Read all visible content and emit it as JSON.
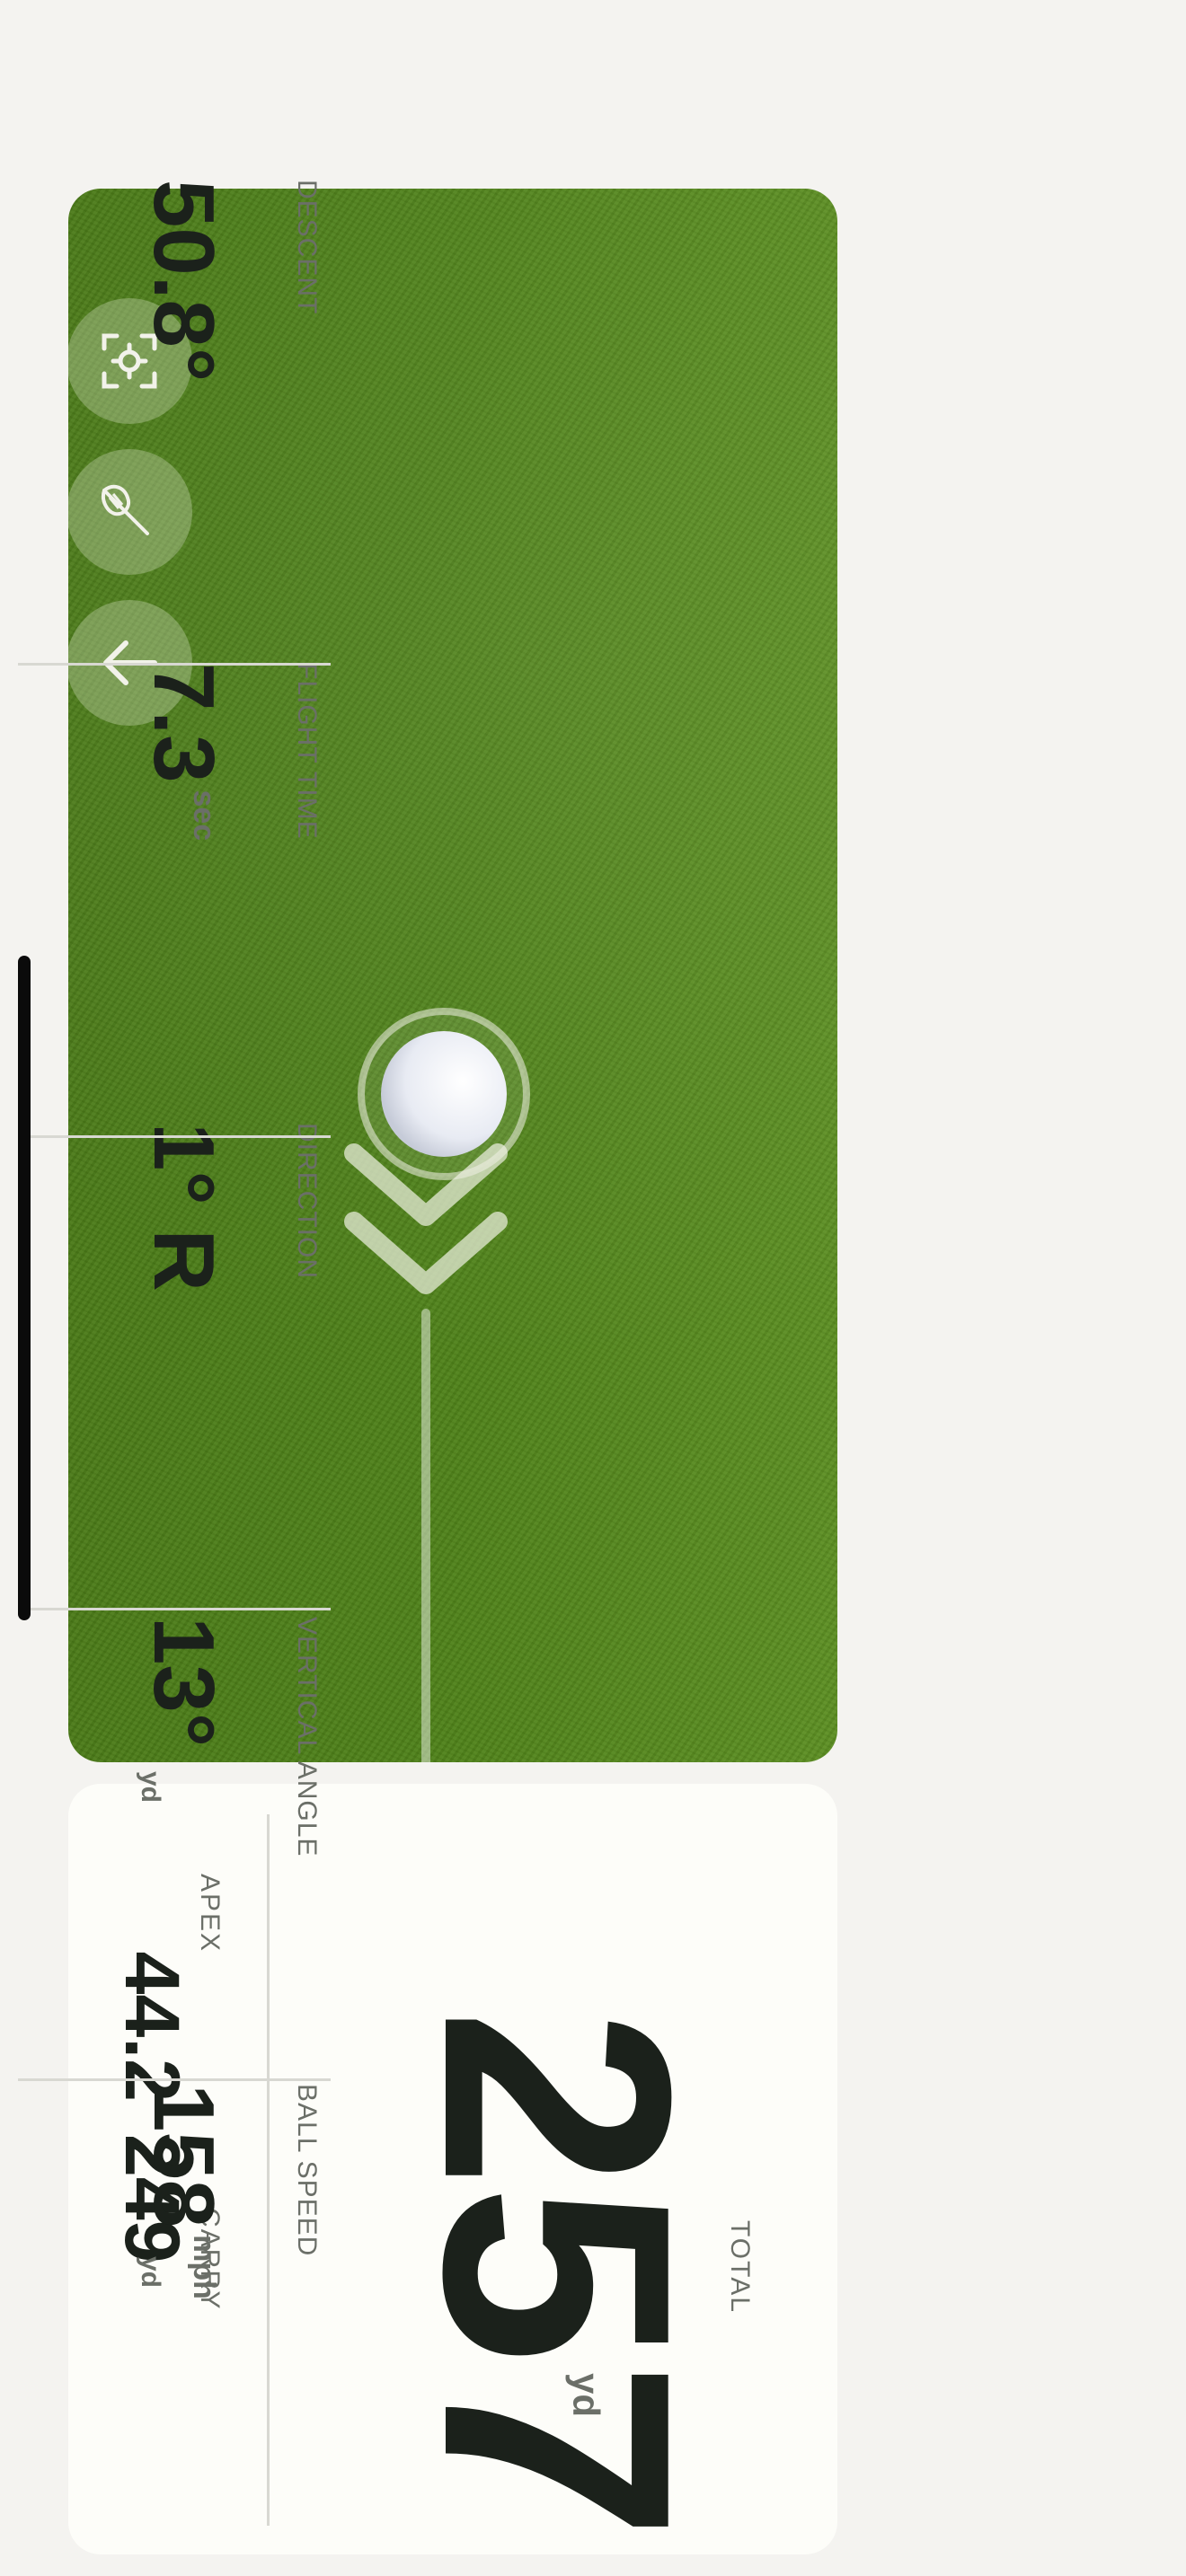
{
  "shot": {
    "total": {
      "label": "TOTAL",
      "value": "257",
      "unit": "yd"
    },
    "carry": {
      "label": "CARRY",
      "value": "249",
      "unit": "yd"
    },
    "apex": {
      "label": "APEX",
      "value": "44.2",
      "unit": "yd"
    }
  },
  "stats": [
    {
      "label": "BALL SPEED",
      "value": "158",
      "unit": "mph"
    },
    {
      "label": "VERTICAL ANGLE",
      "value": "13°",
      "unit": ""
    },
    {
      "label": "DIRECTION",
      "value": "1° R",
      "unit": ""
    },
    {
      "label": "FLIGHT TIME",
      "value": "7.3",
      "unit": "sec"
    },
    {
      "label": "DESCENT",
      "value": "50.8°",
      "unit": ""
    }
  ],
  "controls": {
    "icons": [
      "arrow-down-icon",
      "club-icon",
      "focus-target-icon"
    ]
  },
  "colors": {
    "text_dark": "#1b211b",
    "text_muted": "#6b6f68",
    "grass": "#4f8219",
    "background": "#f4f3f0",
    "card": "#fdfdf9"
  }
}
